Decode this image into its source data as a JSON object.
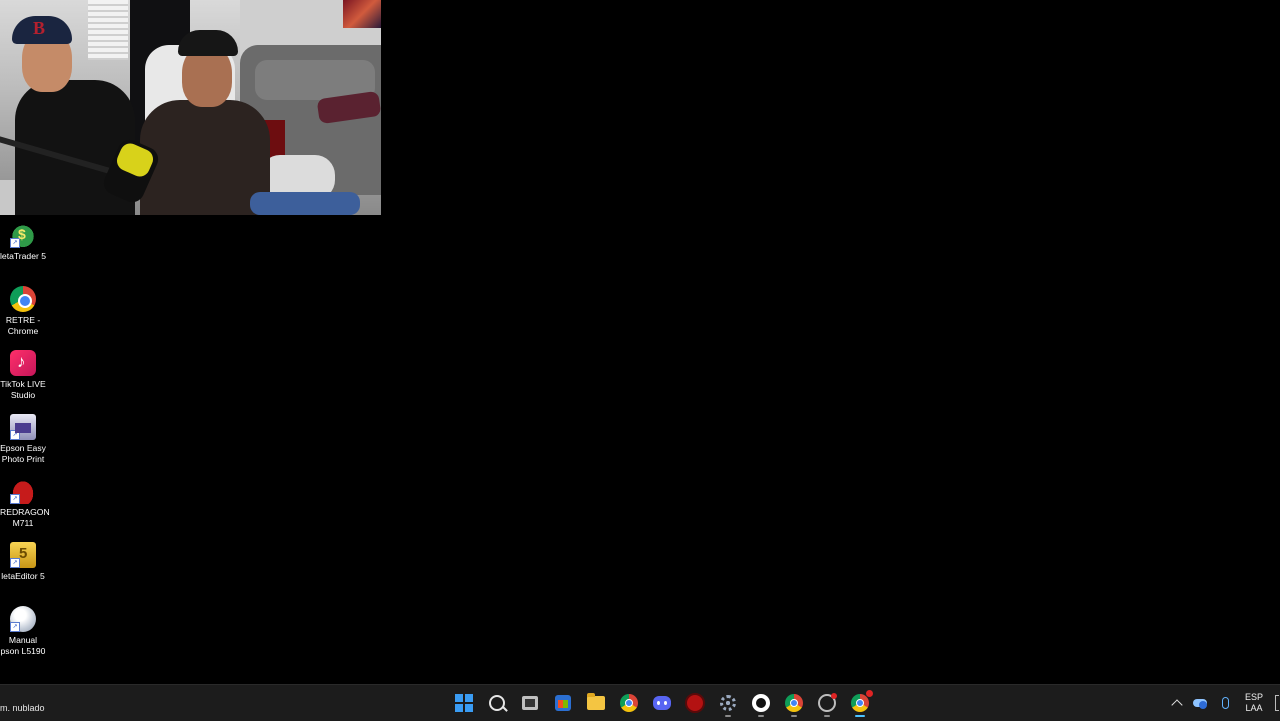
{
  "desktop": {
    "icons": [
      {
        "label": "letaTrader 5",
        "icon": "metatrader5-icon"
      },
      {
        "label_lines": [
          "RETRE -",
          "Chrome"
        ],
        "icon": "chrome-icon"
      },
      {
        "label_lines": [
          "TikTok LIVE",
          "Studio"
        ],
        "icon": "tiktok-live-studio-icon"
      },
      {
        "label_lines": [
          "Epson Easy",
          "Photo Print"
        ],
        "icon": "epson-easy-photo-print-icon"
      },
      {
        "label_lines": [
          "REDRAGON",
          "M711"
        ],
        "icon": "redragon-icon"
      },
      {
        "label": "letaEditor 5",
        "icon": "metaeditor5-icon"
      },
      {
        "label_lines": [
          "Manual",
          "pson L5190"
        ],
        "icon": "manual-disc-icon"
      }
    ]
  },
  "taskbar": {
    "weather_text": "m. nublado",
    "apps": [
      {
        "name": "start",
        "icon": "windows-start-icon"
      },
      {
        "name": "search",
        "icon": "search-icon"
      },
      {
        "name": "task-view",
        "icon": "task-view-icon"
      },
      {
        "name": "store",
        "icon": "microsoft-store-icon"
      },
      {
        "name": "file-explorer",
        "icon": "folder-icon"
      },
      {
        "name": "chrome",
        "icon": "chrome-icon"
      },
      {
        "name": "discord",
        "icon": "discord-icon"
      },
      {
        "name": "red-app",
        "icon": "red-circle-icon"
      },
      {
        "name": "settings",
        "icon": "gear-icon"
      },
      {
        "name": "webcam",
        "icon": "camera-icon"
      },
      {
        "name": "chrome-profile",
        "icon": "chrome-icon"
      },
      {
        "name": "obs",
        "icon": "obs-icon"
      },
      {
        "name": "chrome-active",
        "icon": "chrome-icon"
      }
    ],
    "tray": {
      "language_line1": "ESP",
      "language_line2": "LAA"
    }
  },
  "colors": {
    "desktop_bg": "#000000",
    "taskbar_bg": "#1c1c1c",
    "accent": "#4cc2ff",
    "start_blue": "#3a9cf3"
  }
}
